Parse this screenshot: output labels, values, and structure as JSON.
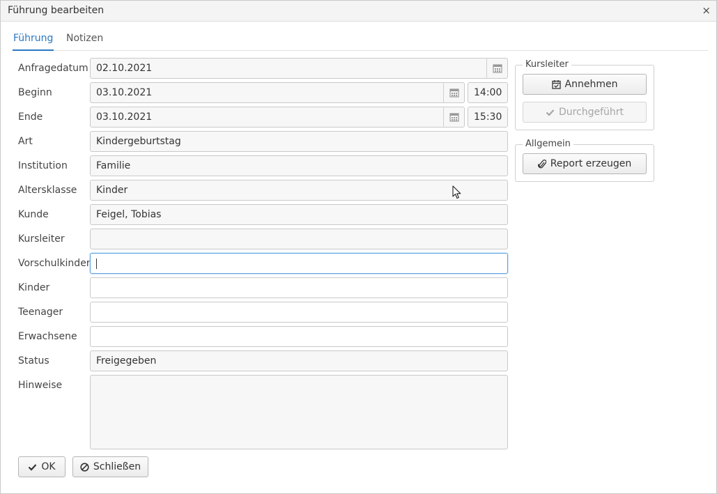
{
  "dialog": {
    "title": "Führung bearbeiten",
    "close_glyph": "×"
  },
  "tabs": [
    {
      "label": "Führung",
      "active": true
    },
    {
      "label": "Notizen",
      "active": false
    }
  ],
  "form": {
    "anfragedatum": {
      "label": "Anfragedatum",
      "value": "02.10.2021"
    },
    "beginn": {
      "label": "Beginn",
      "date": "03.10.2021",
      "time": "14:00"
    },
    "ende": {
      "label": "Ende",
      "date": "03.10.2021",
      "time": "15:30"
    },
    "art": {
      "label": "Art",
      "value": "Kindergeburtstag"
    },
    "institution": {
      "label": "Institution",
      "value": "Familie"
    },
    "altersklasse": {
      "label": "Altersklasse",
      "value": "Kinder"
    },
    "kunde": {
      "label": "Kunde",
      "value": "Feigel, Tobias"
    },
    "kursleiter": {
      "label": "Kursleiter",
      "value": ""
    },
    "vorschulkinder": {
      "label": "Vorschulkinder",
      "value": ""
    },
    "kinder": {
      "label": "Kinder",
      "value": ""
    },
    "teenager": {
      "label": "Teenager",
      "value": ""
    },
    "erwachsene": {
      "label": "Erwachsene",
      "value": ""
    },
    "status": {
      "label": "Status",
      "value": "Freigegeben"
    },
    "hinweise": {
      "label": "Hinweise",
      "value": ""
    }
  },
  "side": {
    "kursleiter_group": {
      "legend": "Kursleiter",
      "annehmen_label": "Annehmen",
      "durchgefuehrt_label": "Durchgeführt"
    },
    "allgemein_group": {
      "legend": "Allgemein",
      "report_label": "Report erzeugen"
    }
  },
  "footer": {
    "ok_label": "OK",
    "close_label": "Schließen"
  },
  "icons": {
    "calendar": "calendar-icon",
    "calendar_check": "calendar-check-icon",
    "check": "check-icon",
    "paperclip": "paperclip-icon",
    "ban": "ban-icon",
    "mouse_pointer": "mouse-pointer-icon"
  },
  "colors": {
    "accent": "#2b78c2",
    "focus_border": "#5aa0e0",
    "field_bg": "#f7f7f7"
  }
}
